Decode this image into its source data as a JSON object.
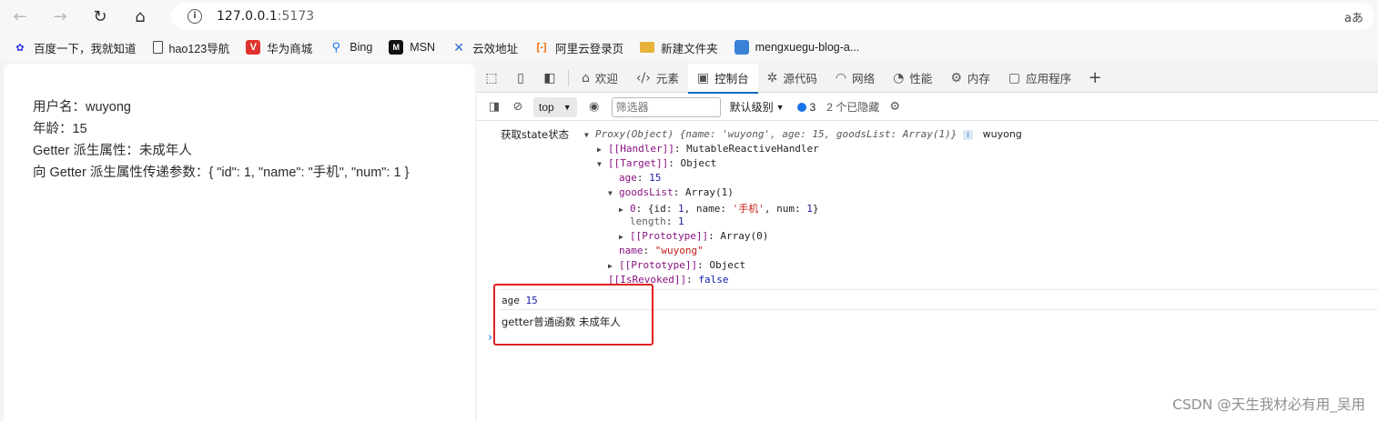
{
  "browser": {
    "back_icon": "arrow-left-icon",
    "forward_icon": "arrow-right-icon",
    "refresh_icon": "refresh-icon",
    "home_icon": "home-icon",
    "url_host": "127.0.0.1",
    "url_port": ":5173",
    "read_aloud": "aあ"
  },
  "bookmarks": [
    {
      "label": "百度一下，我就知道",
      "icon": "baidu-icon",
      "color": "#2932e1"
    },
    {
      "label": "hao123导航",
      "icon": "document-icon",
      "color": "#444444"
    },
    {
      "label": "华为商城",
      "icon": "huawei-icon",
      "color": "#e0332f"
    },
    {
      "label": "Bing",
      "icon": "search-icon",
      "color": "#1a73e8"
    },
    {
      "label": "MSN",
      "icon": "msn-icon",
      "color": "#111111"
    },
    {
      "label": "云效地址",
      "icon": "cross-icon",
      "color": "#2b6cd8"
    },
    {
      "label": "阿里云登录页",
      "icon": "aliyun-icon",
      "color": "#ff6a00"
    },
    {
      "label": "新建文件夹",
      "icon": "folder-icon",
      "color": "#e8b23a"
    },
    {
      "label": "mengxuegu-blog-a...",
      "icon": "bookmark-icon",
      "color": "#3b82d6"
    }
  ],
  "page": {
    "lines": [
      "用户名：wuyong",
      "年龄：15",
      "Getter 派生属性：未成年人",
      "向 Getter 派生属性传递参数：{ \"id\": 1, \"name\": \"手机\", \"num\": 1 }"
    ]
  },
  "devtools": {
    "tabs": [
      {
        "label": "欢迎",
        "icon": "home-icon"
      },
      {
        "label": "元素",
        "icon": "code-icon"
      },
      {
        "label": "控制台",
        "icon": "console-icon",
        "active": true
      },
      {
        "label": "源代码",
        "icon": "bug-icon"
      },
      {
        "label": "网络",
        "icon": "wifi-icon"
      },
      {
        "label": "性能",
        "icon": "gauge-icon"
      },
      {
        "label": "内存",
        "icon": "chip-icon"
      },
      {
        "label": "应用程序",
        "icon": "app-icon"
      }
    ],
    "toolbar": {
      "context": "top",
      "filter_placeholder": "筛选器",
      "levels": "默认级别",
      "message_count": "3",
      "hidden": "2 个已隐藏"
    },
    "console": {
      "log1_label": "获取state状态",
      "proxy_summary_prefix": "Proxy(Object) {name: ",
      "proxy_name_val": "'wuyong'",
      "proxy_age_part": ", age: ",
      "proxy_age_val": "15",
      "proxy_goods_part": ", goodsList: Array(1)}",
      "log1_extra": "wuyong",
      "handler_key": "[[Handler]]",
      "handler_val": ": MutableReactiveHandler",
      "target_key": "[[Target]]",
      "target_val": ": Object",
      "age_key": "age",
      "age_val": "15",
      "goods_key": "goodsList",
      "goods_val": ": Array(1)",
      "item0_key": "0",
      "item0_prefix": ": {id: ",
      "item0_id": "1",
      "item0_name_part": ", name: ",
      "item0_name": "'手机'",
      "item0_num_part": ", num: ",
      "item0_num": "1",
      "item0_end": "}",
      "length_key": "length",
      "length_val": "1",
      "arr_proto_key": "[[Prototype]]",
      "arr_proto_val": ": Array(0)",
      "name_key": "name",
      "name_val": "\"wuyong\"",
      "obj_proto_key": "[[Prototype]]",
      "obj_proto_val": ": Object",
      "revoked_key": "[[IsRevoked]]",
      "revoked_val": "false",
      "log2_label": "age",
      "log2_val": "15",
      "log3_text": "getter普通函数 未成年人"
    }
  },
  "watermark": "CSDN @天生我材必有用_吴用"
}
